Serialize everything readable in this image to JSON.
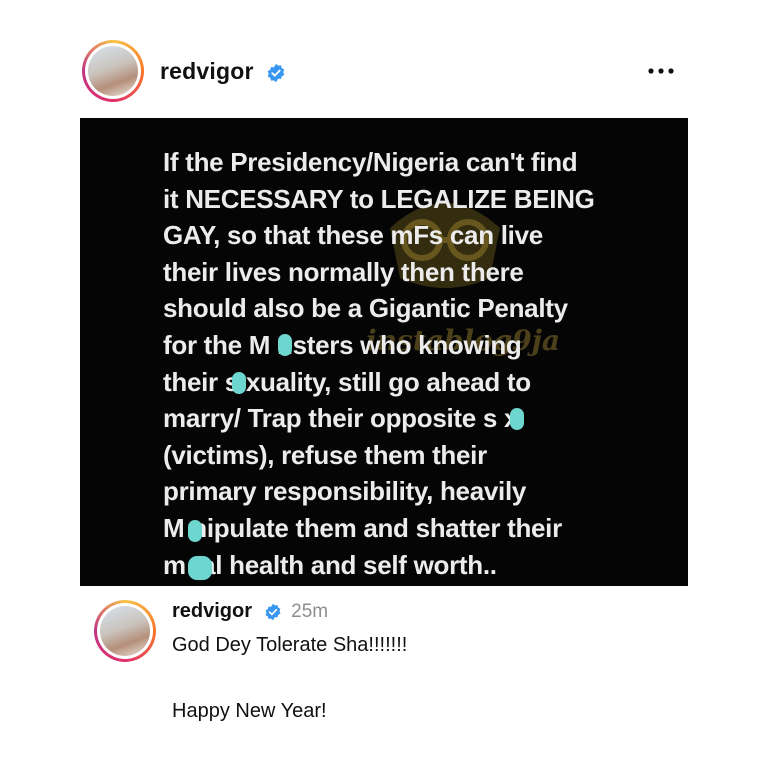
{
  "post": {
    "username": "redvigor",
    "image_text_lines": [
      "If the Presidency/Nigeria can't find",
      "it NECESSARY to LEGALIZE BEING",
      "GAY, so that these mFs can live",
      "their lives normally then there",
      "should also be a Gigantic Penalty",
      "for the M  nsters who knowing",
      "their s  xuality, still go ahead to",
      "marry/ Trap their opposite s  x",
      "(victims), refuse them their",
      "primary responsibility, heavily",
      "M  nipulate them and shatter their",
      "m     tal health and self worth.."
    ],
    "watermark": "instablog9ja"
  },
  "comment": {
    "username": "redvigor",
    "time": "25m",
    "text_line1": "God Dey Tolerate Sha!!!!!!!",
    "text_line2": "Happy New Year!"
  },
  "colors": {
    "verified": "#3897f0",
    "censor": "#6cd6cf",
    "image_bg": "#050505"
  },
  "icons": [
    "verified-badge-icon",
    "more-options-icon",
    "watermark-logo-icon"
  ]
}
